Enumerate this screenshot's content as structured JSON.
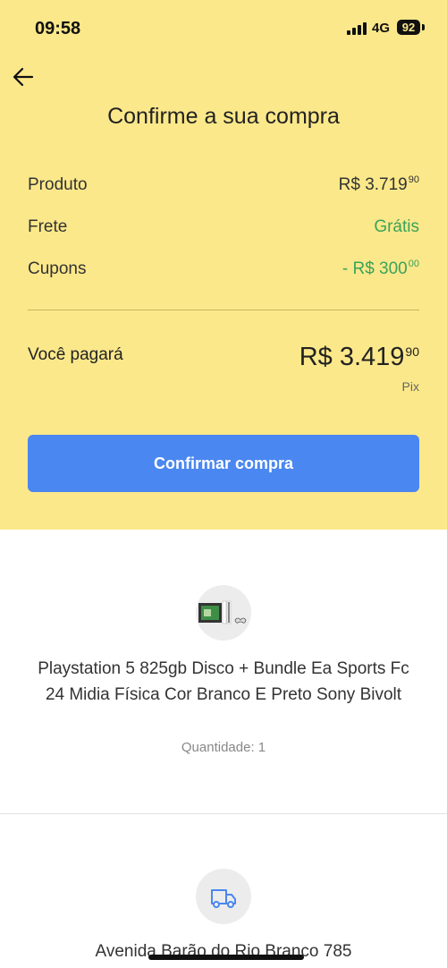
{
  "status_bar": {
    "time": "09:58",
    "network": "4G",
    "battery": "92"
  },
  "header": {
    "title": "Confirme a sua compra"
  },
  "summary": {
    "product": {
      "label": "Produto",
      "main": "R$ 3.719",
      "cents": "90"
    },
    "shipping": {
      "label": "Frete",
      "value": "Grátis"
    },
    "coupons": {
      "label": "Cupons",
      "main": "- R$ 300",
      "cents": "00"
    }
  },
  "total": {
    "label": "Você pagará",
    "main": "R$ 3.419",
    "cents": "90",
    "method": "Pix"
  },
  "confirm_button": {
    "label": "Confirmar compra"
  },
  "product": {
    "name": "Playstation 5 825gb Disco + Bundle Ea Sports Fc 24 Midia Física Cor Branco E Preto Sony Bivolt",
    "quantity": "Quantidade: 1"
  },
  "delivery": {
    "address": "Avenida Barão do Rio Branco 785"
  },
  "colors": {
    "header_bg": "#fbe88a",
    "accent": "#4a87f0",
    "success": "#3aa35a"
  },
  "icons": {
    "back": "arrow-left-icon",
    "delivery": "truck-icon",
    "product": "product-thumbnail"
  }
}
